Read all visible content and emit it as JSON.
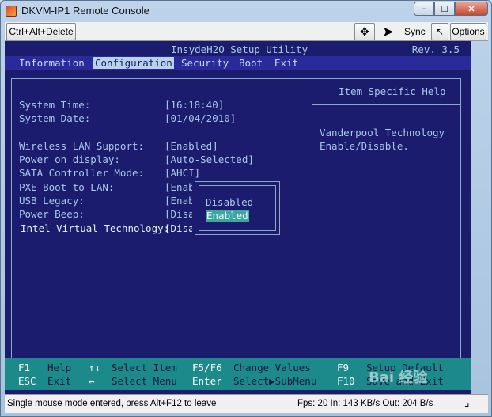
{
  "window": {
    "title": "DKVM-IP1 Remote Console",
    "minimize": "–",
    "maximize": "☐",
    "close": "✕"
  },
  "toolbar": {
    "ctrl_alt_delete": "Ctrl+Alt+Delete",
    "fit_icon": "✥",
    "cursor_icon": "➤",
    "sync": "Sync",
    "arrow_icon": "↖",
    "options": "Options"
  },
  "bios": {
    "title": "InsydeH2O Setup Utility",
    "rev": "Rev. 3.5",
    "menu": [
      {
        "label": "Information",
        "active": false
      },
      {
        "label": "Configuration",
        "active": true
      },
      {
        "label": "Security",
        "active": false
      },
      {
        "label": "Boot",
        "active": false
      },
      {
        "label": "Exit",
        "active": false
      }
    ],
    "settings": [
      {
        "label": "System Time:",
        "value": "[16:18:40]"
      },
      {
        "label": "System Date:",
        "value": "[01/04/2010]"
      },
      {
        "label": "Wireless LAN Support:",
        "value": "[Enabled]"
      },
      {
        "label": "Power on display:",
        "value": "[Auto-Selected]"
      },
      {
        "label": "SATA Controller Mode:",
        "value": "[AHCI]"
      },
      {
        "label": "PXE Boot to LAN:",
        "value": "[Enab"
      },
      {
        "label": "USB Legacy:",
        "value": "[Enab"
      },
      {
        "label": "Power Beep:",
        "value": "[Disa"
      },
      {
        "label": "Intel Virtual Technology:",
        "value": "[Disa"
      }
    ],
    "help_title": "Item Specific Help",
    "help_text": "Vanderpool Technology Enable/Disable.",
    "popup": {
      "options": [
        "Disabled",
        "Enabled"
      ],
      "selected": "Enabled"
    },
    "footer": [
      {
        "key": "F1",
        "desc": "Help"
      },
      {
        "key": "↑↓",
        "desc": "Select Item"
      },
      {
        "key": "F5/F6",
        "desc": "Change Values"
      },
      {
        "key": "F9",
        "desc": "Setup Default"
      },
      {
        "key": "ESC",
        "desc": "Exit"
      },
      {
        "key": "↔",
        "desc": "Select Menu"
      },
      {
        "key": "Enter",
        "desc": "Select▶SubMenu"
      },
      {
        "key": "F10",
        "desc": "Save and Exit"
      }
    ]
  },
  "status": {
    "left": "Single mouse mode entered, press Alt+F12 to leave",
    "right": "Fps: 20 In: 143 KB/s Out: 204 B/s"
  },
  "watermark": "Bai 经验"
}
